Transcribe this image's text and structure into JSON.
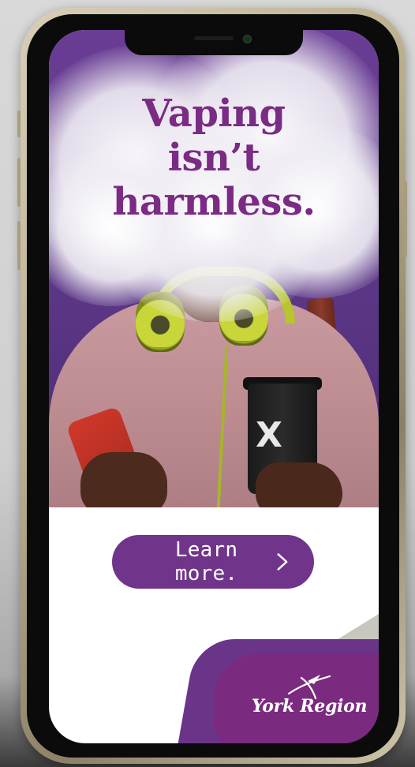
{
  "ad": {
    "headline": [
      "Vaping",
      "isn’t",
      "harmless."
    ],
    "cup_text": "X"
  },
  "cta": {
    "label": "Learn more.",
    "icon": "chevron-right-icon"
  },
  "brand": {
    "name": "York Region",
    "icon": "york-region-logo-mark-icon"
  },
  "colors": {
    "accent_purple": "#70358a",
    "headline_purple": "#7a2b83",
    "headphone_yellow": "#c9d63a"
  }
}
